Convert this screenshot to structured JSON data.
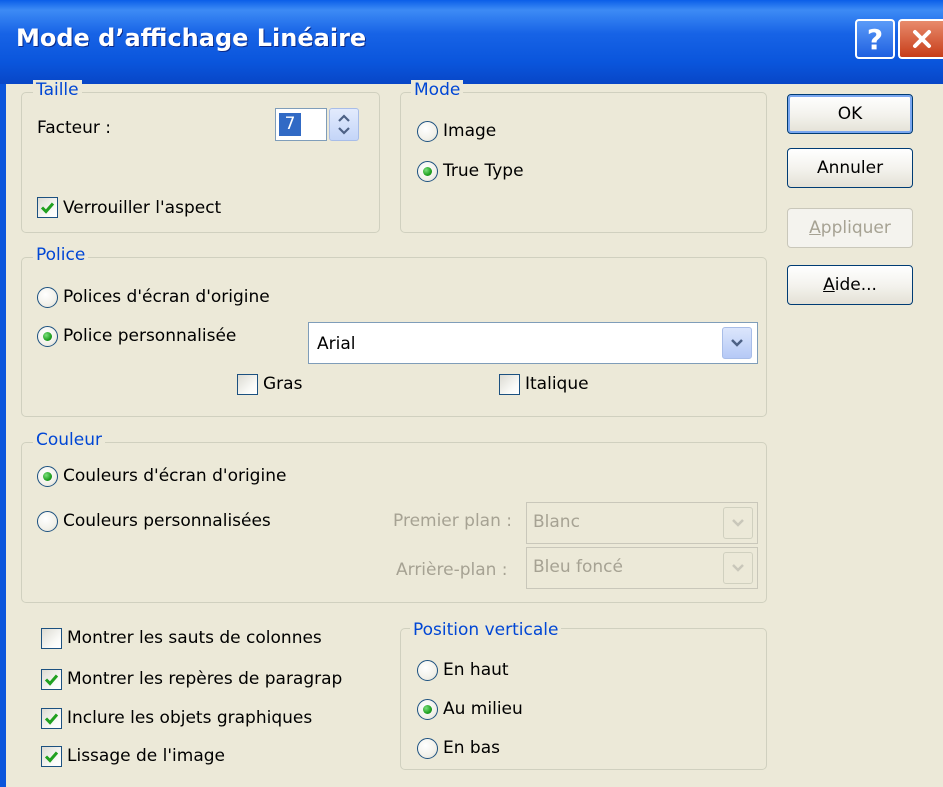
{
  "window": {
    "title": "Mode d’affichage Linéaire",
    "help_glyph": "?",
    "close_glyph": "✕"
  },
  "taille": {
    "legend": "Taille",
    "facteur_label": "Facteur :",
    "facteur_value": "7",
    "verrouiller_label": "Verrouiller l'aspect",
    "verrouiller_checked": true
  },
  "mode": {
    "legend": "Mode",
    "options": [
      {
        "label": "Image",
        "selected": false
      },
      {
        "label": "True Type",
        "selected": true
      }
    ]
  },
  "buttons": {
    "ok": "OK",
    "annuler": "Annuler",
    "appliquer_first": "A",
    "appliquer_rest": "ppliquer",
    "aide_first": "A",
    "aide_rest": "ide..."
  },
  "police": {
    "legend": "Police",
    "origine_label": "Polices d'écran d'origine",
    "origine_selected": false,
    "perso_label": "Police personnalisée",
    "perso_selected": true,
    "font_value": "Arial",
    "gras_label": "Gras",
    "gras_checked": false,
    "italique_label": "Italique",
    "italique_checked": false
  },
  "couleur": {
    "legend": "Couleur",
    "origine_label": "Couleurs d'écran d'origine",
    "origine_selected": true,
    "perso_label": "Couleurs personnalisées",
    "perso_selected": false,
    "premier_plan_label": "Premier plan :",
    "premier_plan_value": "Blanc",
    "arriere_plan_label": "Arrière-plan :",
    "arriere_plan_value": "Bleu foncé"
  },
  "options": [
    {
      "label": "Montrer les sauts de colonnes",
      "checked": false
    },
    {
      "label": "Montrer les repères de paragrap",
      "checked": true
    },
    {
      "label": "Inclure les objets graphiques",
      "checked": true
    },
    {
      "label": "Lissage de l'image",
      "checked": true
    }
  ],
  "position": {
    "legend": "Position verticale",
    "options": [
      {
        "label": "En haut",
        "selected": false
      },
      {
        "label": "Au milieu",
        "selected": true
      },
      {
        "label": "En bas",
        "selected": false
      }
    ]
  },
  "colors": {
    "titlebar": "#0a55dc",
    "face": "#ece9d8",
    "legend": "#0046d5",
    "check": "#21a121"
  }
}
